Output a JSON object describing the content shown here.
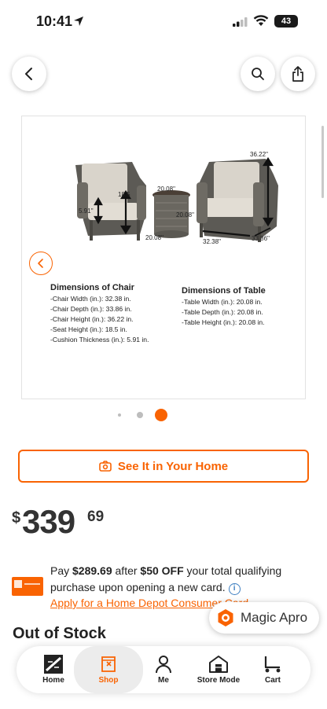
{
  "status_bar": {
    "time": "10:41",
    "battery": "43"
  },
  "header": {
    "back_icon": "chevron-left-icon",
    "search_icon": "search-icon",
    "share_icon": "share-icon"
  },
  "gallery": {
    "chair_title": "Dimensions of Chair",
    "chair_lines": [
      "-Chair Width (in.): 32.38 in.",
      "-Chair Depth (in.): 33.86 in.",
      "-Chair Height (in.): 36.22 in.",
      "-Seat Height (in.): 18.5 in.",
      "-Cushion Thickness (in.): 5.91 in."
    ],
    "table_title": "Dimensions of Table",
    "table_lines": [
      "-Table Width (in.): 20.08 in.",
      "-Table Depth (in.): 20.08 in.",
      "-Table Height (in.): 20.08 in."
    ],
    "measurements": {
      "chair_height": "36.22''",
      "seat_height": "18.5",
      "cushion": "5.91''",
      "table_top": "20.08''",
      "table_side": "20.08''",
      "table_bottom": "20.08''",
      "chair_width": "32.38''",
      "chair_depth": "33.86''"
    },
    "pagination": {
      "count": 3,
      "active_index": 2
    }
  },
  "see_it_button": "See It in Your Home",
  "price": {
    "currency": "$",
    "dollars": "339",
    "cents": "69"
  },
  "promo": {
    "pre": "Pay ",
    "amount": "$289.69",
    "mid": " after ",
    "discount": "$50 OFF",
    "post": " your total qualifying purchase upon opening a new card.",
    "link": "Apply for a Home Depot Consumer Card"
  },
  "magic_apron": "Magic Apro",
  "stock_status": "Out of Stock",
  "tabs": [
    {
      "label": "Home",
      "icon": "home-depot-logo-icon"
    },
    {
      "label": "Shop",
      "icon": "shop-icon"
    },
    {
      "label": "Me",
      "icon": "person-icon"
    },
    {
      "label": "Store Mode",
      "icon": "store-icon"
    },
    {
      "label": "Cart",
      "icon": "cart-icon"
    }
  ],
  "active_tab": "Shop",
  "colors": {
    "accent": "#f96302",
    "info": "#3e7fc1"
  }
}
